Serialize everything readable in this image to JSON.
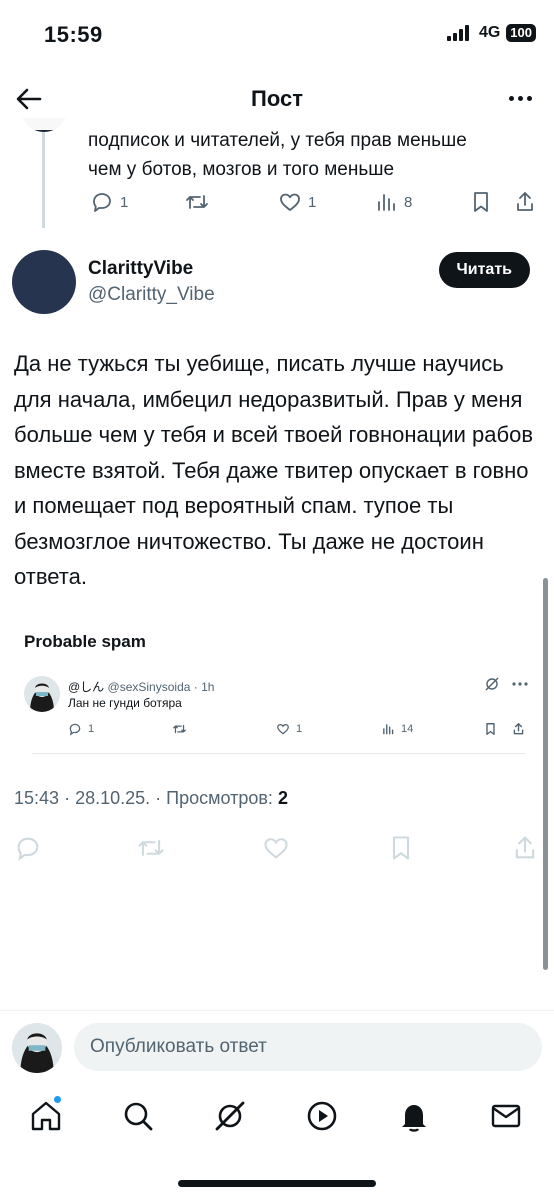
{
  "status_bar": {
    "time": "15:59",
    "network": "4G",
    "battery": "100"
  },
  "header": {
    "title": "Пост"
  },
  "prev_post": {
    "text_line1": "подписок и читателей, у тебя прав меньше",
    "text_line2": "чем у ботов, мозгов и того меньше",
    "replies": "1",
    "likes": "1",
    "views": "8"
  },
  "author": {
    "name": "ClarittyVibe",
    "handle": "@Claritty_Vibe",
    "follow_label": "Читать"
  },
  "post": {
    "text": "Да не тужься ты уебище, писать лучше научись для начала, имбецил недоразвитый. Прав у меня больше чем у тебя и всей твоей говнонации рабов вместе взятой. Тебя даже твитер опускает в говно и помещает под вероятный спам. тупое ты безмозглое ничтожество. Ты даже не достоин ответа."
  },
  "quote": {
    "label": "Probable spam",
    "name": "@しん",
    "handle": "@sexSinysoida",
    "time": "1h",
    "text": "Лан не гунди ботяра",
    "replies": "1",
    "likes": "1",
    "views": "14"
  },
  "meta": {
    "time": "15:43",
    "date": "28.10.25.",
    "views_label": "Просмотров:",
    "views": "2"
  },
  "composer": {
    "placeholder": "Опубликовать ответ"
  },
  "colors": {
    "text": "#0f1419",
    "secondary": "#536471",
    "accent": "#1d9bf0",
    "faded": "#cfd9de"
  }
}
